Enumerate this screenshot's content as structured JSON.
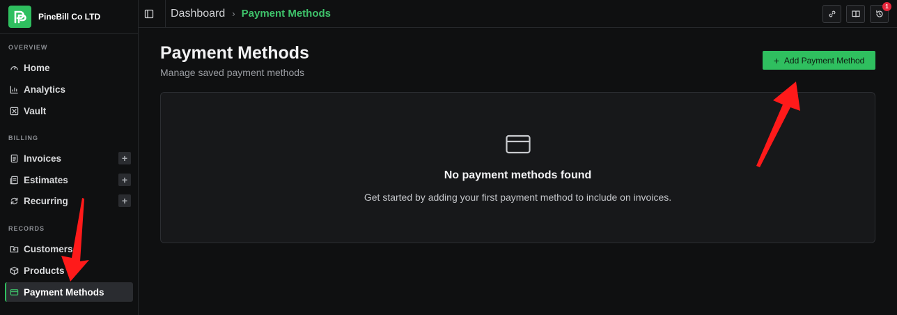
{
  "sidebar": {
    "brand_name": "PineBill Co LTD",
    "sections": {
      "overview": "OVERVIEW",
      "billing": "BILLING",
      "records": "RECORDS"
    },
    "items": {
      "home": "Home",
      "analytics": "Analytics",
      "vault": "Vault",
      "invoices": "Invoices",
      "estimates": "Estimates",
      "recurring": "Recurring",
      "customers": "Customers",
      "products": "Products",
      "payment_methods": "Payment Methods"
    },
    "plus_label": "+"
  },
  "header": {
    "breadcrumb_root": "Dashboard",
    "breadcrumb_separator": "›",
    "breadcrumb_current": "Payment Methods",
    "history_badge_count": "1",
    "icons": [
      "sidebar-toggle-icon",
      "link-icon",
      "book-icon",
      "history-icon"
    ]
  },
  "main": {
    "title": "Payment Methods",
    "subtitle": "Manage saved payment methods",
    "add_button_label": "Add Payment Method",
    "add_button_plus": "+",
    "empty_state": {
      "title": "No payment methods found",
      "description": "Get started by adding your first payment method to include on invoices."
    }
  },
  "colors": {
    "accent": "#2fbf5f",
    "background": "#0f1011",
    "card": "#17181a",
    "annotation_arrow": "#ff1a1a",
    "badge": "#e5263b"
  }
}
